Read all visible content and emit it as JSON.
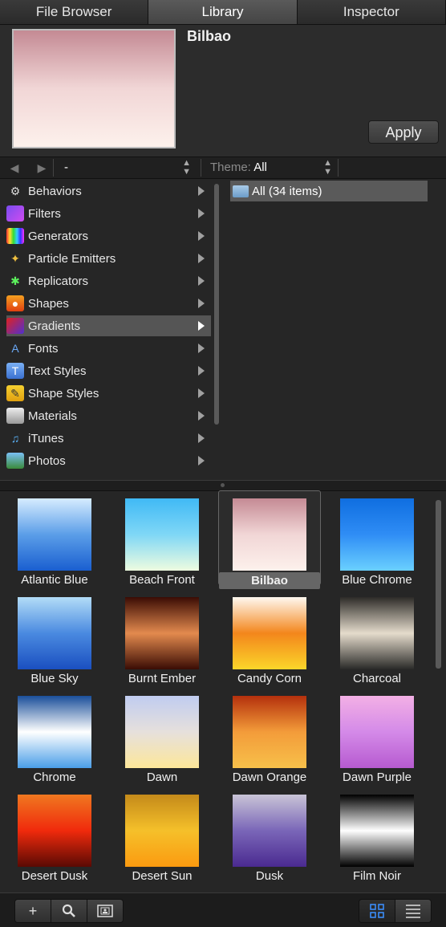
{
  "tabs": [
    {
      "label": "File Browser"
    },
    {
      "label": "Library"
    },
    {
      "label": "Inspector"
    }
  ],
  "preview": {
    "title": "Bilbao",
    "apply_label": "Apply",
    "swatch_colors": [
      "#c48a94",
      "#f1d6d6",
      "#fdf1ec"
    ]
  },
  "nav": {
    "back_icon": "◀",
    "forward_icon": "▶",
    "path_value": "-",
    "theme_label": "Theme:",
    "theme_value": "All"
  },
  "categories": [
    {
      "label": "Behaviors",
      "icon": "gear-icon"
    },
    {
      "label": "Filters",
      "icon": "filters-icon"
    },
    {
      "label": "Generators",
      "icon": "generators-icon"
    },
    {
      "label": "Particle Emitters",
      "icon": "particle-emitters-icon"
    },
    {
      "label": "Replicators",
      "icon": "replicators-icon"
    },
    {
      "label": "Shapes",
      "icon": "shapes-icon"
    },
    {
      "label": "Gradients",
      "icon": "gradients-icon",
      "selected": true
    },
    {
      "label": "Fonts",
      "icon": "fonts-icon"
    },
    {
      "label": "Text Styles",
      "icon": "text-styles-icon"
    },
    {
      "label": "Shape Styles",
      "icon": "shape-styles-icon"
    },
    {
      "label": "Materials",
      "icon": "materials-icon"
    },
    {
      "label": "iTunes",
      "icon": "music-note-icon"
    },
    {
      "label": "Photos",
      "icon": "photos-icon"
    }
  ],
  "folder": {
    "label": "All (34 items)"
  },
  "gradients": [
    {
      "label": "Atlantic Blue",
      "colors": [
        "#d6ecff",
        "#5b9ee8",
        "#1a5fd0"
      ]
    },
    {
      "label": "Beach Front",
      "colors": [
        "#40b9f5",
        "#7fd7f6",
        "#eefce0"
      ]
    },
    {
      "label": "Bilbao",
      "colors": [
        "#c48a94",
        "#f1d6d6",
        "#fdf1ec"
      ],
      "selected": true
    },
    {
      "label": "Blue Chrome",
      "colors": [
        "#0f6ee0",
        "#2f8df5",
        "#6ad0ff"
      ]
    },
    {
      "label": "Blue Sky",
      "colors": [
        "#b2dcf7",
        "#4a8ae0",
        "#1a4fc0"
      ]
    },
    {
      "label": "Burnt Ember",
      "colors": [
        "#3a0c04",
        "#e38a4e",
        "#3a0c04"
      ]
    },
    {
      "label": "Candy Corn",
      "colors": [
        "#fff8f0",
        "#f3861c",
        "#fbd62a"
      ]
    },
    {
      "label": "Charcoal",
      "colors": [
        "#2d2b28",
        "#e5dccc",
        "#2a2a28"
      ]
    },
    {
      "label": "Chrome",
      "colors": [
        "#1a4f9a",
        "#ffffff",
        "#4a9ee8"
      ]
    },
    {
      "label": "Dawn",
      "colors": [
        "#c0ccf0",
        "#e6e0dc",
        "#fde79a"
      ]
    },
    {
      "label": "Dawn Orange",
      "colors": [
        "#b4300c",
        "#f39c3a",
        "#f7c04a"
      ]
    },
    {
      "label": "Dawn Purple",
      "colors": [
        "#f3b0e5",
        "#d48ae8",
        "#b65ad0"
      ]
    },
    {
      "label": "Desert Dusk",
      "colors": [
        "#f07820",
        "#f02a0c",
        "#5a0a04"
      ]
    },
    {
      "label": "Desert Sun",
      "colors": [
        "#c48a1a",
        "#f5c02a",
        "#fb9a10"
      ]
    },
    {
      "label": "Dusk",
      "colors": [
        "#c9c4d6",
        "#7a66b8",
        "#4a2a90"
      ]
    },
    {
      "label": "Film Noir",
      "colors": [
        "#000000",
        "#ffffff",
        "#000000"
      ]
    }
  ],
  "toolbar": {
    "add_icon": "+",
    "search_icon": "⌕",
    "grid_view_icon": "grid-view-icon",
    "list_view_icon": "list-view-icon"
  }
}
